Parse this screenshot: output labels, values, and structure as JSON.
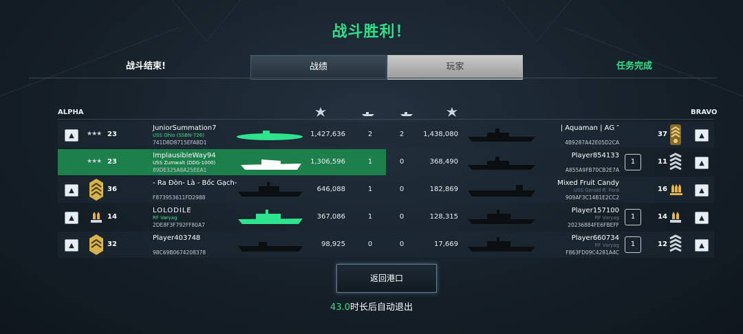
{
  "title": "战斗胜利！",
  "tabs": {
    "left": "战斗结束!",
    "stats": "战绩",
    "players": "玩家",
    "right": "任务完成"
  },
  "teams": {
    "left": "ALPHA",
    "right": "BRAVO"
  },
  "colors": {
    "accent": "#2fe08a",
    "highlight": "#1d7f4b",
    "ship_green": "#2ee38e",
    "silhouette": "#0b0f12"
  },
  "rows": [
    {
      "left": {
        "level": "23",
        "name": "JuniorSummation7",
        "ship": "USS Ohio (SSBN-726)",
        "id": "741D8D8715EFA8D1",
        "damage": "1,427,636",
        "kills": "2",
        "col3": "2",
        "score": "1,438,080"
      },
      "right": {
        "name": "| Aquaman | AG ″",
        "id": "4B9287A42E05D2CA",
        "level": "37"
      }
    },
    {
      "left": {
        "level": "23",
        "name": "ImplausibleWay94",
        "ship": "USS Zumwalt (DDG-1000)",
        "id": "89DE325A8A25EEA1",
        "damage": "1,306,596",
        "kills": "1",
        "col3": "0",
        "score": "368,490"
      },
      "right": {
        "name": "Player854133",
        "id": "A855A9FB70CB2E7A",
        "level": "11",
        "badge": "1"
      }
    },
    {
      "left": {
        "level": "36",
        "name": "- Ra Đòn- Là - Bốc Gạch-",
        "ship": "",
        "id": "F873953611FD2988",
        "damage": "646,088",
        "kills": "1",
        "col3": "0",
        "score": "182,869"
      },
      "right": {
        "name": "Mixed Fruit Candy",
        "id": "909AF3C14B1E2CC2",
        "level": "16",
        "ship": "USS Gerald R. Ford"
      }
    },
    {
      "left": {
        "level": "14",
        "name": "LOLODILE",
        "ship": "RF Varyag",
        "id": "2DE8F3F792FF80A7",
        "damage": "367,086",
        "kills": "1",
        "col3": "0",
        "score": "128,315"
      },
      "right": {
        "name": "Player157100",
        "id": "20236884FE6FBEFF",
        "level": "14",
        "badge": "1",
        "ship": "RF Varyag"
      }
    },
    {
      "left": {
        "level": "32",
        "name": "Player403748",
        "ship": "",
        "id": "98C69B0674208378",
        "damage": "98,925",
        "kills": "0",
        "col3": "0",
        "score": "17,669"
      },
      "right": {
        "name": "Player660734",
        "id": "F863FD09C4281A4C",
        "level": "12",
        "badge": "1",
        "ship": "RF Varyag"
      }
    }
  ],
  "buttons": {
    "return": "返回港口"
  },
  "countdown": {
    "seconds": "43.0",
    "text": "时长后自动退出"
  },
  "icons": [
    "thumbs-up-icon",
    "star-rank-icon",
    "chevron-rank-icon",
    "damage-icon",
    "ship-kill-icon"
  ]
}
